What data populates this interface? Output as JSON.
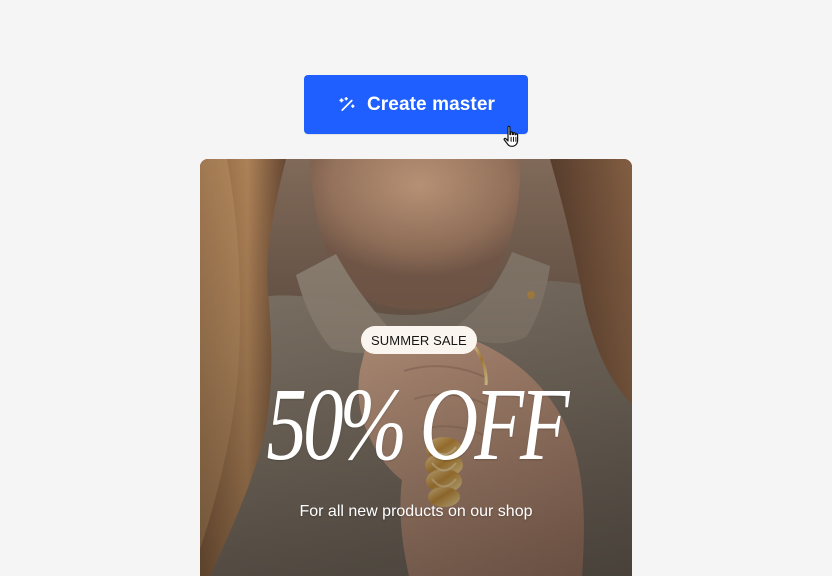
{
  "toolbar": {
    "create_master_label": "Create master",
    "create_master_icon": "magic-wand-icon",
    "accent": "#1f5fff"
  },
  "banner": {
    "badge_text": "SUMMER SALE",
    "headline": "50% OFF",
    "subtext": "For all new products on our shop",
    "image_subject": "woman-with-gold-rings-photo"
  },
  "cursor": {
    "icon": "hand-pointer-icon"
  }
}
